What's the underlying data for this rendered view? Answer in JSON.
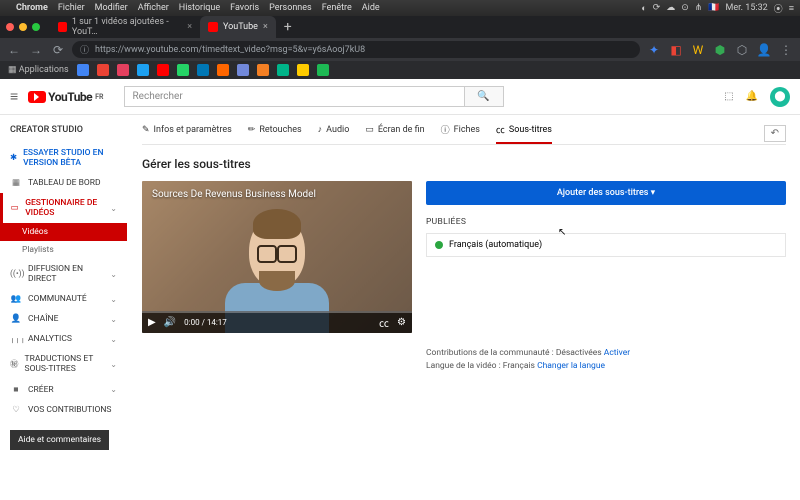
{
  "mac": {
    "app": "Chrome",
    "menus": [
      "Fichier",
      "Modifier",
      "Afficher",
      "Historique",
      "Favoris",
      "Personnes",
      "Fenêtre",
      "Aide"
    ],
    "clock": "Mer. 15:32",
    "flag": "🇫🇷"
  },
  "browser": {
    "tabs": [
      {
        "title": "1 sur 1 vidéos ajoutées - YouT…",
        "active": false
      },
      {
        "title": "YouTube",
        "active": true
      }
    ],
    "url": "https://www.youtube.com/timedtext_video?msg=5&v=y6sAooj7kU8",
    "bookmarks_label": "Applications"
  },
  "yt": {
    "brand": "YouTube",
    "region": "FR",
    "search_placeholder": "Rechercher"
  },
  "sidebar": {
    "title": "CREATOR STUDIO",
    "beta": "ESSAYER STUDIO EN VERSION BÊTA",
    "items": [
      {
        "icon": "▦",
        "label": "TABLEAU DE BORD"
      },
      {
        "icon": "▭",
        "label": "GESTIONNAIRE DE VIDÉOS",
        "active": true
      },
      {
        "icon": "((•))",
        "label": "DIFFUSION EN DIRECT"
      },
      {
        "icon": "👥",
        "label": "COMMUNAUTÉ"
      },
      {
        "icon": "👤",
        "label": "CHAÎNE"
      },
      {
        "icon": "╷╷╷",
        "label": "ANALYTICS"
      },
      {
        "icon": "㊙",
        "label": "TRADUCTIONS ET SOUS-TITRES"
      },
      {
        "icon": "■",
        "label": "CRÉER"
      },
      {
        "icon": "♡",
        "label": "VOS CONTRIBUTIONS"
      }
    ],
    "subitems": {
      "videos": "Vidéos",
      "playlists": "Playlists"
    },
    "help": "Aide et commentaires"
  },
  "tabs": {
    "info": "Infos et paramètres",
    "retouches": "Retouches",
    "audio": "Audio",
    "endscreen": "Écran de fin",
    "cards": "Fiches",
    "subtitles": "Sous-titres"
  },
  "page": {
    "heading": "Gérer les sous-titres",
    "video_title": "Sources De Revenus Business Model",
    "time_current": "0:00",
    "time_total": "14:17",
    "add_button": "Ajouter des sous-titres ▾",
    "published_label": "PUBLIÉES",
    "published_item": "Français (automatique)",
    "contrib_label": "Contributions de la communauté :",
    "contrib_state": "Désactivées",
    "contrib_action": "Activer",
    "lang_label": "Langue de la vidéo :",
    "lang_value": "Français",
    "lang_action": "Changer la langue"
  }
}
